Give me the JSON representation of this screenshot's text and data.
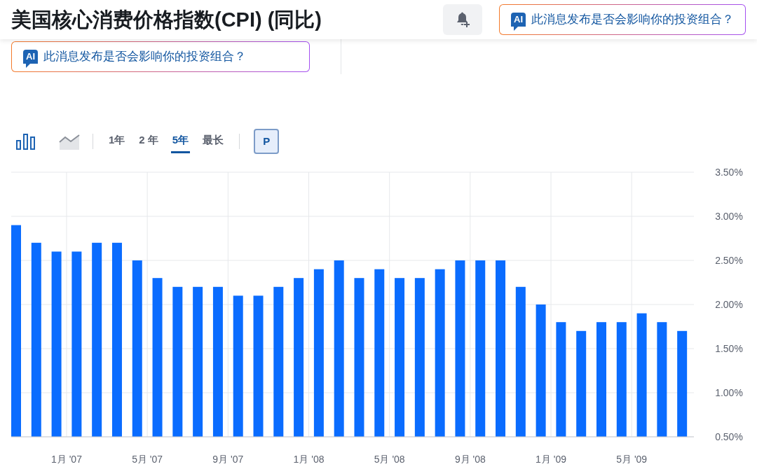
{
  "header": {
    "title": "美国核心消费价格指数(CPI) (同比)",
    "ai_button": {
      "badge": "AI",
      "label": "此消息发布是否会影响你的投资组合？"
    }
  },
  "ai_prompt": {
    "badge": "AI",
    "label": "此消息发布是否会影响你的投资组合？"
  },
  "toolbar": {
    "chart_types": [
      {
        "kind": "bar",
        "selected": true
      },
      {
        "kind": "area",
        "selected": false
      }
    ],
    "ranges": [
      {
        "label": "1年",
        "selected": false
      },
      {
        "label": "2 年",
        "selected": false
      },
      {
        "label": "5年",
        "selected": true
      },
      {
        "label": "最长",
        "selected": false
      }
    ],
    "p_button": {
      "label": "P",
      "selected": true
    }
  },
  "chart_data": {
    "type": "bar",
    "color": "#0a6cff",
    "values": [
      2.9,
      2.7,
      2.6,
      2.6,
      2.7,
      2.7,
      2.5,
      2.3,
      2.2,
      2.2,
      2.2,
      2.1,
      2.1,
      2.2,
      2.3,
      2.4,
      2.5,
      2.3,
      2.4,
      2.3,
      2.3,
      2.4,
      2.5,
      2.5,
      2.5,
      2.2,
      2.0,
      1.8,
      1.7,
      1.8,
      1.8,
      1.9,
      1.8,
      1.7
    ],
    "ylim": [
      0.5,
      3.5
    ],
    "yticks": [
      {
        "value": 0.5,
        "label": "0.50%"
      },
      {
        "value": 1.0,
        "label": "1.00%"
      },
      {
        "value": 1.5,
        "label": "1.50%"
      },
      {
        "value": 2.0,
        "label": "2.00%"
      },
      {
        "value": 2.5,
        "label": "2.50%"
      },
      {
        "value": 3.0,
        "label": "3.00%"
      },
      {
        "value": 3.5,
        "label": "3.50%"
      }
    ],
    "grid": true
  },
  "x_axis_labels": [
    "1月 '07",
    "5月 '07",
    "9月 '07",
    "1月 '08",
    "5月 '08",
    "9月 '08",
    "1月 '09",
    "5月 '09"
  ]
}
